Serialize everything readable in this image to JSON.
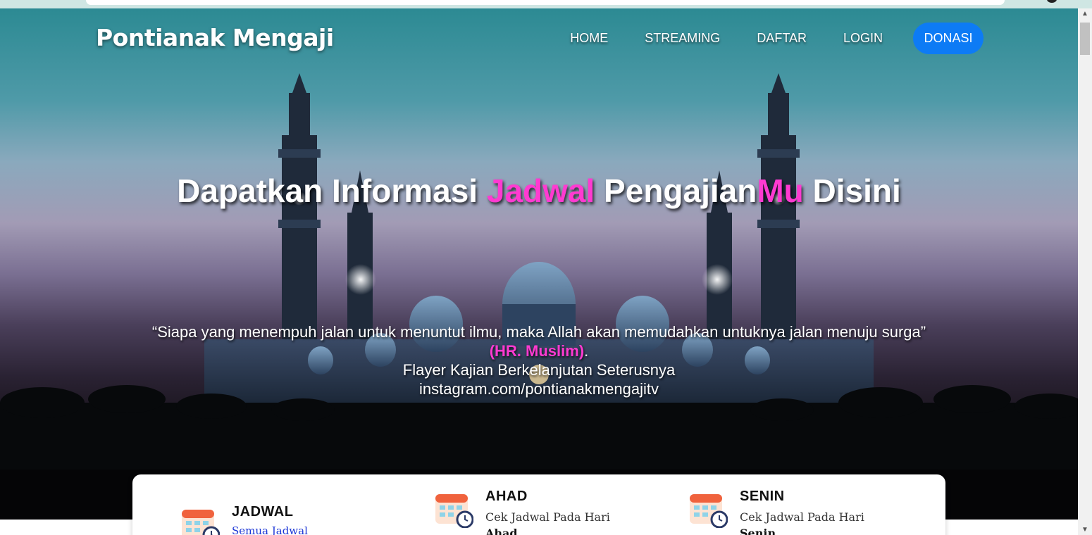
{
  "site": {
    "logo": "Pontianak Mengaji"
  },
  "nav": {
    "items": [
      {
        "label": "HOME"
      },
      {
        "label": "STREAMING"
      },
      {
        "label": "DAFTAR"
      },
      {
        "label": "LOGIN"
      }
    ],
    "donate_label": "DONASI",
    "donate_color": "#0d7bf5"
  },
  "hero": {
    "headline_part1": "Dapatkan Informasi ",
    "headline_accent1": "Jadwal",
    "headline_part2": " Pengajian",
    "headline_accent2": "Mu",
    "headline_part3": " Disini",
    "accent_color": "#ff3ad1",
    "quote": "“Siapa yang menempuh jalan untuk menuntut ilmu, maka Allah akan memudahkan untuknya jalan menuju surga”",
    "quote_source": "(HR. Muslim)",
    "quote_source_suffix": ".",
    "flyer_text": "Flayer Kajian Berkelanjutan Seterusnya",
    "instagram": "instagram.com/pontianakmengajitv"
  },
  "schedule": {
    "items": [
      {
        "title": "JADWAL",
        "link": "Semua Jadwal",
        "icon": "calendar-icon"
      },
      {
        "title": "AHAD",
        "subtitle": "Cek Jadwal Pada Hari",
        "day": "Ahad",
        "icon": "calendar-icon"
      },
      {
        "title": "SENIN",
        "subtitle": "Cek Jadwal Pada Hari",
        "day": "Senin",
        "icon": "calendar-icon"
      }
    ]
  }
}
